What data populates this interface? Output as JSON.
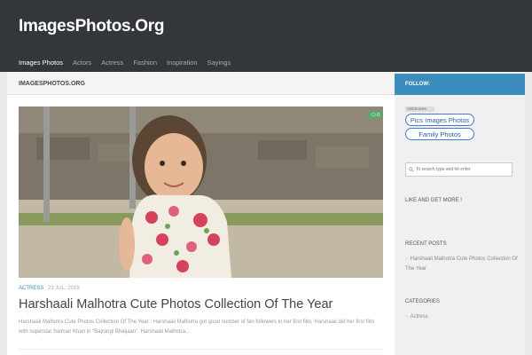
{
  "header": {
    "site_title": "ImagesPhotos.Org",
    "nav": [
      "Images Photos",
      "Actors",
      "Actress",
      "Fashion",
      "Inspiration",
      "Sayings"
    ],
    "active_nav": "Images Photos"
  },
  "main": {
    "breadcrumb": "IMAGESPHOTOS.ORG",
    "post": {
      "comment_count": "0",
      "category": "ACTRESS",
      "date": "23 JUL, 2019",
      "title": "Harshaali Malhotra Cute Photos Collection Of The Year",
      "excerpt": "Harshaali Malhotra Cute Photos Collection Of The Year : Harshaali Malhotra got good number of fan followers in her first film, Harshaali did her first film with superstar Salman Khan in \"Bajrangi Bhaijaan\". Harshaali Malhotra..."
    }
  },
  "sidebar": {
    "follow_label": "FOLLOW:",
    "adchoices_label": "AdChoices",
    "ad_links": [
      "Pics Images Photos",
      "Family Photos"
    ],
    "search_placeholder": "To search type and hit enter",
    "like_title": "LIKE AND GET MORE !",
    "recent_posts_title": "RECENT POSTS",
    "recent_posts": [
      "Harshaali Malhotra Cute Photos Collection Of The Year"
    ],
    "categories_title": "CATEGORIES",
    "categories": [
      "Actress"
    ]
  },
  "colors": {
    "header_bg": "#33363b",
    "accent_blue": "#3b8dbd",
    "comment_green": "#5aa96e"
  }
}
